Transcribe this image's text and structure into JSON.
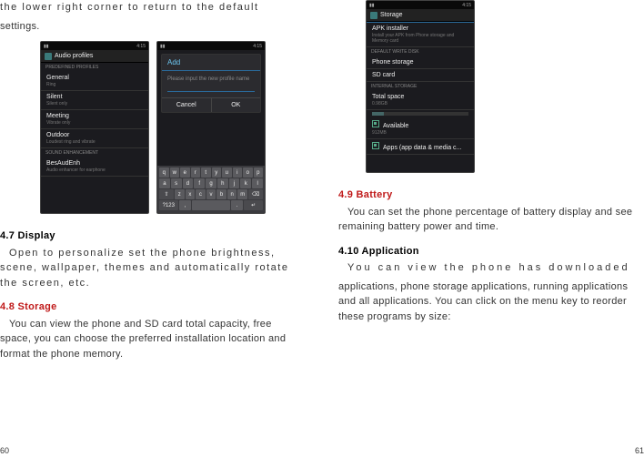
{
  "left": {
    "intro1": "the lower right corner to return to the default",
    "intro2": "settings.",
    "shot1": {
      "time": "4:15",
      "title": "Audio profiles",
      "hdr1": "PREDEFINED PROFILES",
      "rows": [
        {
          "t": "General",
          "s": "Ring"
        },
        {
          "t": "Silent",
          "s": "Silent only"
        },
        {
          "t": "Meeting",
          "s": "Vibrate only"
        },
        {
          "t": "Outdoor",
          "s": "Loudest ring and vibrate"
        }
      ],
      "hdr2": "SOUND ENHANCEMENT",
      "row2": {
        "t": "BesAudEnh",
        "s": "Audio enhancer for earphone"
      }
    },
    "shot2": {
      "time": "4:15",
      "dialog_title": "Add",
      "placeholder": "Please input the new profile name",
      "cancel": "Cancel",
      "ok": "OK",
      "keys": [
        [
          "q",
          "w",
          "e",
          "r",
          "t",
          "y",
          "u",
          "i",
          "o",
          "p"
        ],
        [
          "a",
          "s",
          "d",
          "f",
          "g",
          "h",
          "j",
          "k",
          "l"
        ],
        [
          "⇧",
          "z",
          "x",
          "c",
          "v",
          "b",
          "n",
          "m",
          "⌫"
        ],
        [
          "?123",
          ",",
          "",
          ".",
          " ↵"
        ]
      ]
    },
    "h47": "4.7 Display",
    "p47": "Open to personalize set the phone brightness, scene, wallpaper, themes and automatically rotate the screen, etc.",
    "h48": "4.8 Storage",
    "p48": "You can view the phone and SD card total capacity, free space, you can choose the preferred installation location and format the phone memory.",
    "page": "60"
  },
  "right": {
    "shot3": {
      "time": "4:15",
      "title": "Storage",
      "rows": [
        {
          "t": "APK installer",
          "s": "Install your APK from Phone storage and Memory card"
        }
      ],
      "hdr1": "DEFAULT WRITE DISK",
      "r1": "Phone storage",
      "r2": "SD card",
      "hdr2": "INTERNAL STORAGE",
      "total": "Total space",
      "total_v": "0.98GB",
      "avail": "Available",
      "avail_v": "912MB",
      "apps": "Apps (app data & media c..."
    },
    "h49": "4.9  Battery",
    "p49": "You can set the phone percentage of battery display and see remaining battery power and time.",
    "h410": "4.10 Application",
    "p410a": "You can view the phone has downloaded",
    "p410b": "applications, phone storage applications, running applications and all applications. You can click on the menu key to reorder these programs by size:",
    "page": "61"
  }
}
